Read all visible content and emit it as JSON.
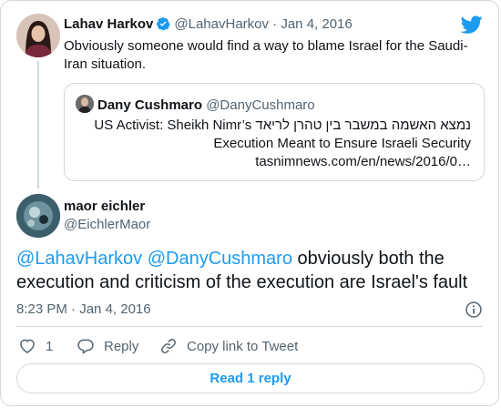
{
  "tweet1": {
    "author_name": "Lahav Harkov",
    "author_handle": "@LahavHarkov",
    "separator": "·",
    "date": "Jan 4, 2016",
    "text": "Obviously someone would find a way to blame Israel for the Saudi-Iran situation.",
    "verified_icon": "verified-badge-icon"
  },
  "quote": {
    "author_name": "Dany Cushmaro",
    "author_handle": "@DanyCushmaro",
    "line1": "נמצא האשמה במשבר בין טהרן לריאד US Activist: Sheikh Nimr’s",
    "line2": "Execution Meant to Ensure Israeli Security",
    "line3": "tasnimnews.com/en/news/2016/0…"
  },
  "tweet2": {
    "author_name": "maor eichler",
    "author_handle": "@EichlerMaor",
    "mention1": "@LahavHarkov",
    "mention2": "@DanyCushmaro",
    "text": " obviously both the execution and criticism of the execution are Israel's fault",
    "time": "8:23 PM",
    "separator": "·",
    "date": "Jan 4, 2016"
  },
  "actions": {
    "like_count": "1",
    "reply_label": "Reply",
    "copy_label": "Copy link to Tweet"
  },
  "read_reply_label": "Read 1 reply",
  "icons": {
    "logo": "twitter-bird-icon",
    "info": "info-icon",
    "like": "heart-icon",
    "reply": "speech-bubble-icon",
    "copy": "link-icon"
  },
  "colors": {
    "accent": "#1d9bf0",
    "text": "#0f1419",
    "muted": "#536471",
    "border": "#cfd9de"
  }
}
